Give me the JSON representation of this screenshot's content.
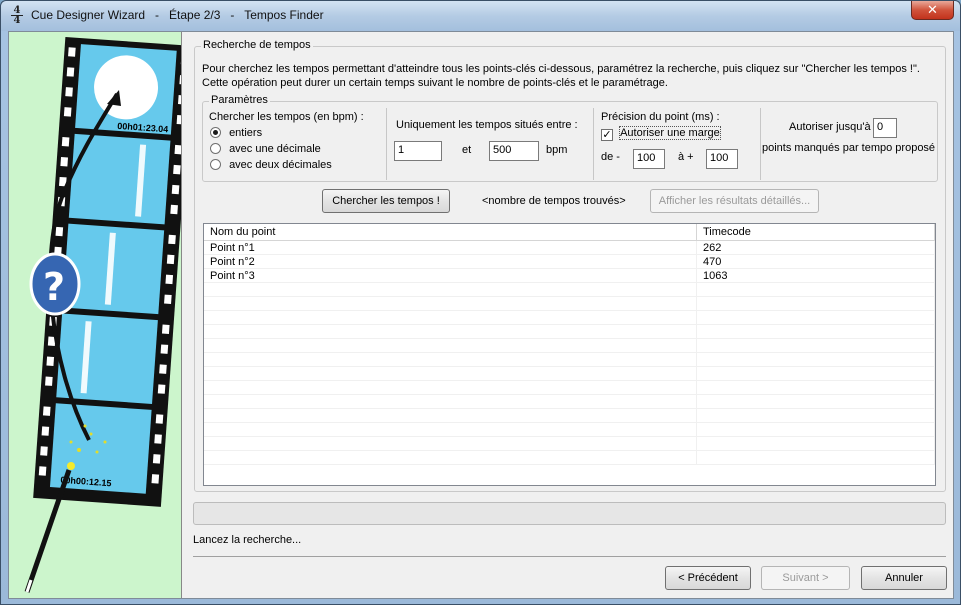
{
  "window": {
    "title": "Cue Designer Wizard   -   Étape 2/3   -   Tempos Finder",
    "close": "✕",
    "app_icon_top": "4",
    "app_icon_bottom": "4"
  },
  "side_panel": {
    "timecode_top": "00h01:23.04",
    "timecode_bottom": "00h00:12.15",
    "question_mark": "?"
  },
  "search_group": {
    "label": "Recherche de tempos",
    "intro": "Pour cherchez les tempos permettant d'atteindre tous les points-clés ci-dessous, paramétrez la recherche, puis cliquez sur \"Chercher les tempos !\". Cette opération peut durer un certain temps suivant le nombre de points-clés et le paramétrage."
  },
  "params": {
    "label": "Paramètres",
    "bpm_label": "Chercher les tempos (en bpm) :",
    "radios": [
      {
        "label": "entiers",
        "checked": true
      },
      {
        "label": "avec une décimale",
        "checked": false
      },
      {
        "label": "avec deux décimales",
        "checked": false
      }
    ],
    "range_label": "Uniquement les tempos situés entre :",
    "range_min": "1",
    "range_and": "et",
    "range_max": "500",
    "range_unit": "bpm",
    "precision_label": "Précision du point (ms) :",
    "margin_checkbox": "Autoriser une marge",
    "margin_checked": true,
    "from_label": "de -",
    "from_value": "100",
    "to_label": "à +",
    "to_value": "100",
    "allow_label": "Autoriser jusqu'à",
    "allow_value": "0",
    "missed_label": "points manqués par tempo proposé"
  },
  "actions": {
    "search_button": "Chercher les tempos !",
    "found_text": "<nombre de tempos trouvés>",
    "details_button": "Afficher les résultats détaillés..."
  },
  "table": {
    "columns": [
      "Nom du point",
      "Timecode"
    ],
    "rows": [
      [
        "Point n°1",
        "262"
      ],
      [
        "Point n°2",
        "470"
      ],
      [
        "Point n°3",
        "1063"
      ]
    ]
  },
  "status": "Lancez la recherche...",
  "footer": {
    "previous": "< Précédent",
    "next": "Suivant >",
    "cancel": "Annuler"
  }
}
